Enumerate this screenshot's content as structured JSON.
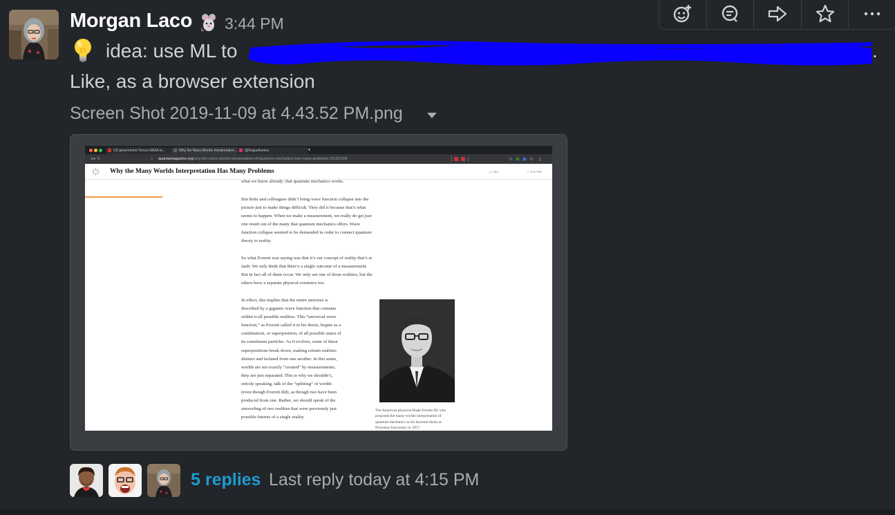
{
  "message": {
    "sender": "Morgan Laco",
    "status_emoji": "mouse-emoji",
    "timestamp": "3:44 PM",
    "lead_emoji": "lightbulb-emoji",
    "text_start": "idea: use ML to",
    "text_end": ".",
    "text_line2": "Like, as a browser extension"
  },
  "attachment": {
    "file_name": "Screen Shot 2019-11-09 at 4.43.52 PM.png"
  },
  "browser": {
    "tabs": [
      {
        "label": "US government 'forces NASA to...",
        "favicon_color": "#d93025"
      },
      {
        "label": "Why the Many-Worlds Interpretation...",
        "favicon_color": "#5f6368"
      },
      {
        "label": "@RogueAurora",
        "favicon_color": "#cc3a62"
      }
    ],
    "url_host": "quantamagazine.org",
    "url_path": "/why-the-many-worlds-interpretation-of-quantum-mechanics-has-many-problems-20181018/",
    "article_title": "Why the Many Worlds Interpretation Has Many Problems",
    "comments_count": "344",
    "share_label": "SHARE"
  },
  "article": {
    "cut_line": "what we know already: that quantum mechanics works.",
    "para1": [
      "But Bohr and colleagues didn’t bring wave function collapse into the",
      "picture just to make things difficult. They did it because that’s what",
      "seems to happen. When we make a measurement, we really do get just",
      "one result out of the many that quantum mechanics offers. Wave",
      "function collapse seemed to be demanded in order to connect quantum",
      "theory to reality."
    ],
    "para2": [
      "So what Everett was saying was that it’s our concept of reality that’s at",
      "fault. We only think that there’s a single outcome of a measurement.",
      "But in fact all of them occur. We only see one of those realities, but the",
      "others have a separate physical existence too."
    ],
    "para3": [
      "In effect, this implies that the entire universe is",
      "described by a gigantic wave function that contains",
      "within it all possible realities. This “universal wave",
      "function,” as Everett called it in his thesis, begins as a",
      "combination, or superposition, of all possible states of",
      "its constituent particles. As it evolves, some of these",
      "superpositions break down, making certain realities",
      "distinct and isolated from one another. In this sense,",
      "worlds are not exactly “created” by measurements;",
      "they are just separated. This is why we shouldn’t,",
      "strictly speaking, talk of the “splitting” of worlds",
      "(even though Everett did), as though two have been",
      "produced from one. Rather, we should speak of the",
      "unraveling of two realities that were previously just",
      "possible futures of a single reality."
    ],
    "caption": [
      "The American physicist Hugh Everett III, who",
      "proposed the many-worlds interpretation of",
      "quantum mechanics in his doctoral thesis at",
      "Princeton University in 1957."
    ]
  },
  "toolbar": {
    "actions": [
      "add-reaction-icon",
      "reply-in-thread-icon",
      "share-message-icon",
      "save-star-icon",
      "more-actions-icon"
    ]
  },
  "thread": {
    "replies_label": "5 replies",
    "last_reply": "Last reply today at 4:15 PM"
  },
  "colors": {
    "background": "#222529",
    "link": "#1d9bd1",
    "muted": "#ababad",
    "redaction": "#0a00ff"
  }
}
